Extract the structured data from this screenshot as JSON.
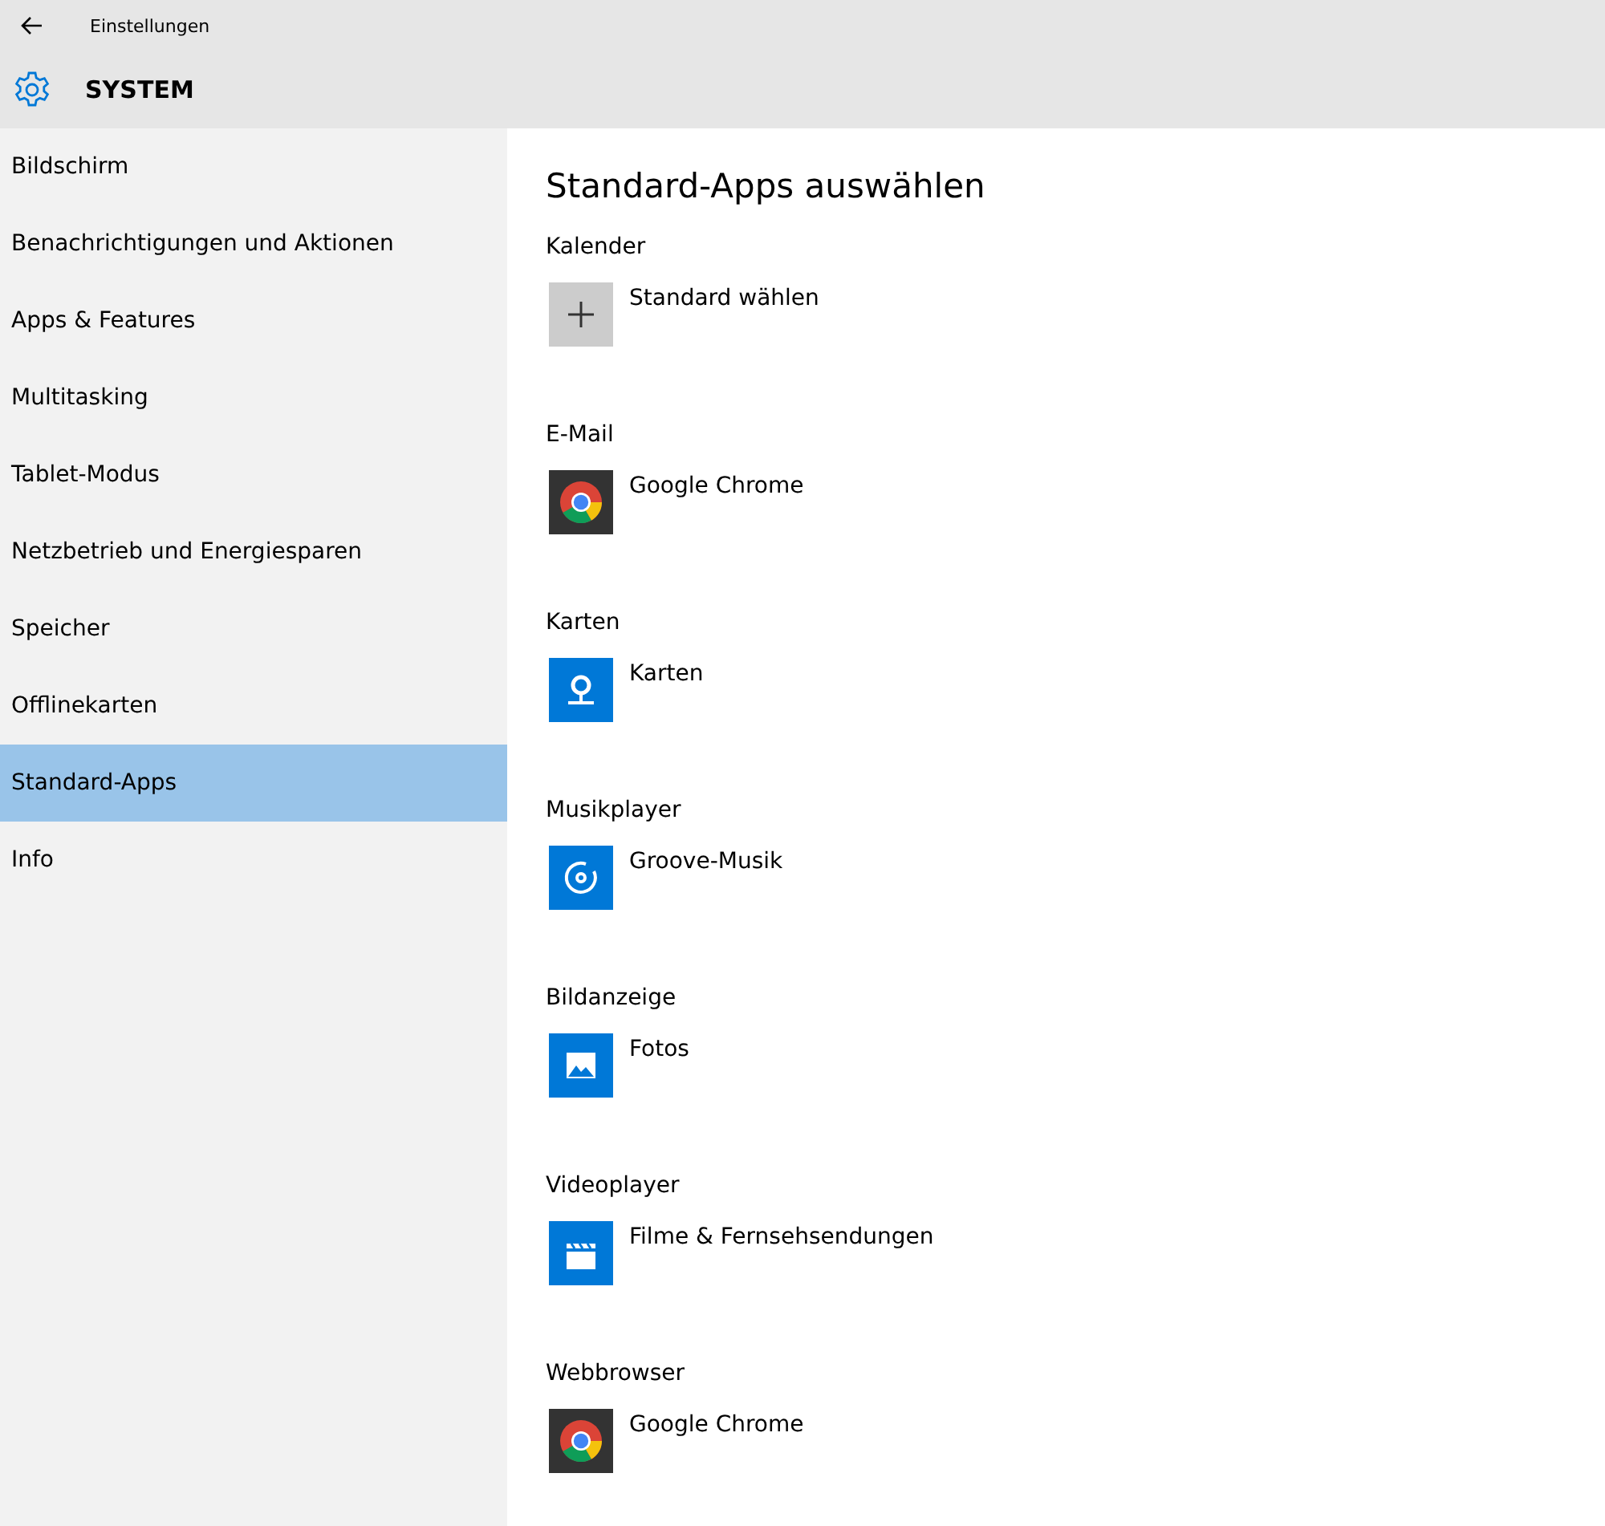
{
  "window": {
    "title": "Einstellungen"
  },
  "header": {
    "title": "SYSTEM"
  },
  "sidebar": {
    "items": [
      {
        "label": "Bildschirm",
        "selected": false
      },
      {
        "label": "Benachrichtigungen und Aktionen",
        "selected": false
      },
      {
        "label": "Apps & Features",
        "selected": false
      },
      {
        "label": "Multitasking",
        "selected": false
      },
      {
        "label": "Tablet-Modus",
        "selected": false
      },
      {
        "label": "Netzbetrieb und Energiesparen",
        "selected": false
      },
      {
        "label": "Speicher",
        "selected": false
      },
      {
        "label": "Offlinekarten",
        "selected": false
      },
      {
        "label": "Standard-Apps",
        "selected": true
      },
      {
        "label": "Info",
        "selected": false
      }
    ]
  },
  "content": {
    "title": "Standard-Apps auswählen",
    "sections": [
      {
        "label": "Kalender",
        "app": {
          "kind": "add",
          "name": "Standard wählen"
        }
      },
      {
        "label": "E-Mail",
        "app": {
          "kind": "chrome",
          "name": "Google Chrome"
        }
      },
      {
        "label": "Karten",
        "app": {
          "kind": "maps",
          "name": "Karten"
        }
      },
      {
        "label": "Musikplayer",
        "app": {
          "kind": "music",
          "name": "Groove-Musik"
        }
      },
      {
        "label": "Bildanzeige",
        "app": {
          "kind": "photos",
          "name": "Fotos"
        }
      },
      {
        "label": "Videoplayer",
        "app": {
          "kind": "video",
          "name": "Filme & Fernsehsendungen"
        }
      },
      {
        "label": "Webbrowser",
        "app": {
          "kind": "chrome",
          "name": "Google Chrome"
        }
      }
    ]
  }
}
